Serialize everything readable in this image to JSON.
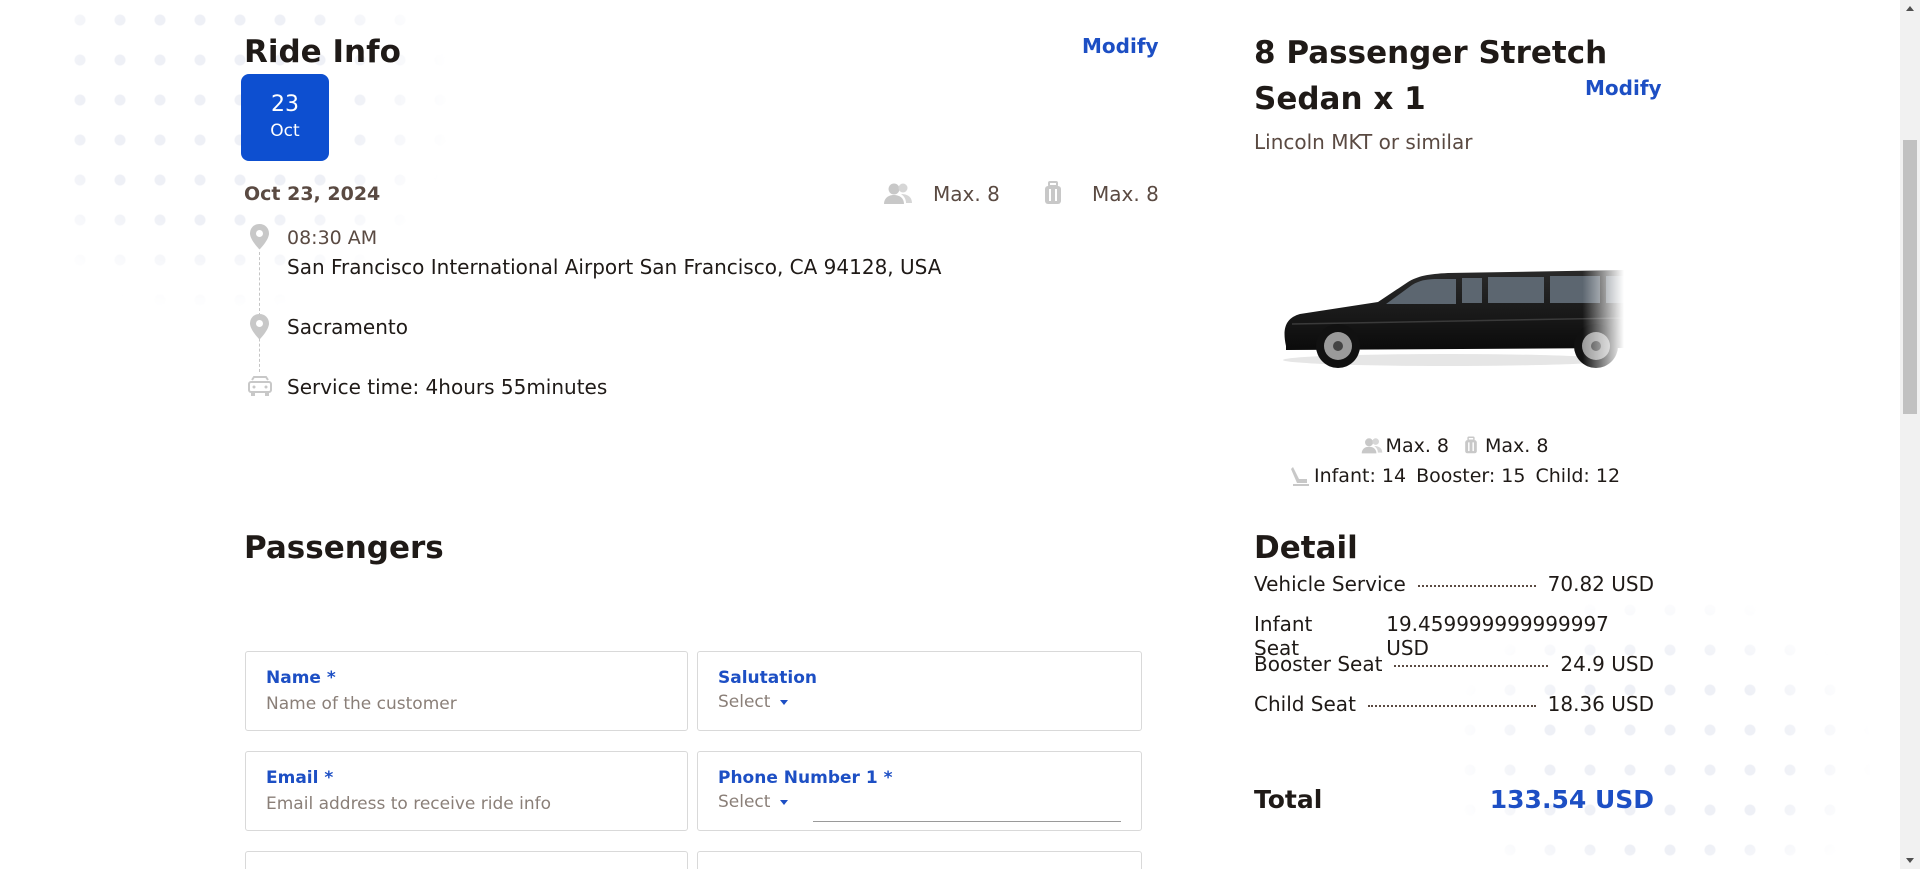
{
  "ride_info": {
    "title": "Ride Info",
    "modify_label": "Modify",
    "date_badge": {
      "day": "23",
      "month": "Oct"
    },
    "date_full": "Oct 23, 2024",
    "max_passengers": "Max. 8",
    "max_luggage": "Max. 8",
    "pickup_time": "08:30 AM",
    "pickup_address": "San Francisco International Airport San Francisco, CA 94128, USA",
    "destination": "Sacramento",
    "service_time": "Service time: 4hours 55minutes"
  },
  "passengers": {
    "title": "Passengers",
    "fields": {
      "name_label": "Name *",
      "name_placeholder": "Name of the customer",
      "salutation_label": "Salutation",
      "salutation_value": "Select",
      "email_label": "Email *",
      "email_placeholder": "Email address to receive ride info",
      "phone_label": "Phone Number 1 *",
      "phone_code_value": "Select"
    }
  },
  "vehicle": {
    "title": "8 Passenger Stretch Sedan x 1",
    "modify_label": "Modify",
    "subtitle": "Lincoln MKT or similar",
    "max_passengers": "Max. 8",
    "max_luggage": "Max. 8",
    "infant": "Infant: 14",
    "booster": "Booster: 15",
    "child": "Child: 12",
    "car_color": "#151515"
  },
  "detail": {
    "title": "Detail",
    "lines": [
      {
        "label": "Vehicle Service",
        "value": "70.82 USD"
      },
      {
        "label": "Infant Seat",
        "value": "19.459999999999997 USD"
      },
      {
        "label": "Booster Seat",
        "value": "24.9 USD"
      },
      {
        "label": "Child Seat",
        "value": "18.36 USD"
      }
    ],
    "total_label": "Total",
    "total_value": "133.54 USD"
  },
  "colors": {
    "accent": "#1d4fc4",
    "badge": "#0d4fd0",
    "text_dark": "#1f1a17",
    "text_muted": "#5a4a42"
  },
  "icons": [
    "passengers-icon",
    "luggage-icon",
    "location-pin-icon",
    "car-icon",
    "car-seat-icon"
  ]
}
